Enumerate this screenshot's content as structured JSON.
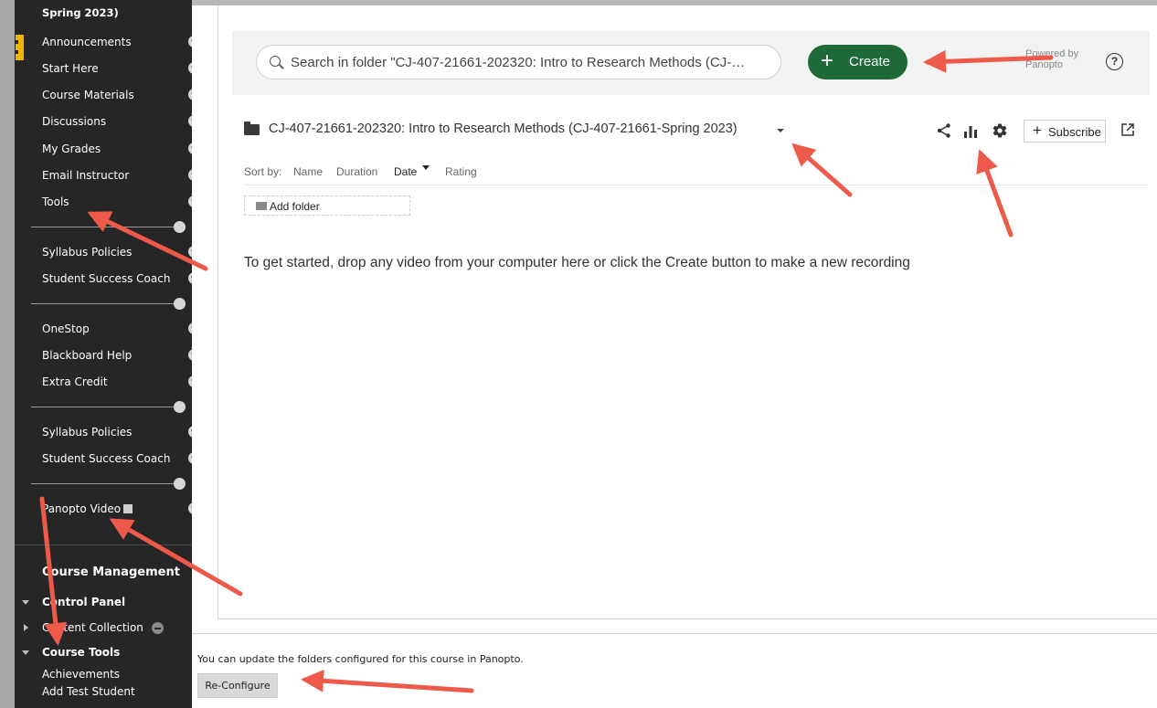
{
  "sidebar": {
    "course_title": "Spring 2023)",
    "items": [
      {
        "label": "Announcements"
      },
      {
        "label": "Start Here"
      },
      {
        "label": "Course Materials"
      },
      {
        "label": "Discussions"
      },
      {
        "label": "My Grades"
      },
      {
        "label": "Email Instructor"
      },
      {
        "label": "Tools"
      },
      {
        "label": "Syllabus Policies"
      },
      {
        "label": "Student Success Coach"
      },
      {
        "label": "OneStop"
      },
      {
        "label": "Blackboard Help"
      },
      {
        "label": "Extra Credit"
      },
      {
        "label": "Syllabus Policies"
      },
      {
        "label": "Student Success Coach"
      },
      {
        "label": "Panopto Video"
      }
    ],
    "course_management": {
      "heading": "Course Management",
      "control_panel": "Control Panel",
      "content_collection": "Content Collection",
      "course_tools": "Course Tools",
      "links": [
        "Achievements",
        "Add Test Student"
      ]
    }
  },
  "panopto": {
    "search_placeholder": "Search in folder \"CJ-407-21661-202320: Intro to Research Methods (CJ-…",
    "create_label": "Create",
    "powered_by": "Powered by Panopto",
    "folder_name": "CJ-407-21661-202320: Intro to Research Methods (CJ-407-21661-Spring 2023)",
    "subscribe_label": "Subscribe",
    "sort": {
      "prefix": "Sort by:",
      "options": [
        "Name",
        "Duration",
        "Date",
        "Rating"
      ],
      "active": "Date"
    },
    "add_folder_label": "Add folder",
    "empty_message": "To get started, drop any video from your computer here or click the Create button to make a new recording"
  },
  "footer": {
    "message": "You can update the folders configured for this course in Panopto.",
    "reconfigure_label": "Re-Configure"
  },
  "colors": {
    "sidebar_bg": "#262626",
    "create_green": "#1e6b37",
    "arrow_red": "#ee5a4a",
    "active_tab": "#f0b400"
  }
}
